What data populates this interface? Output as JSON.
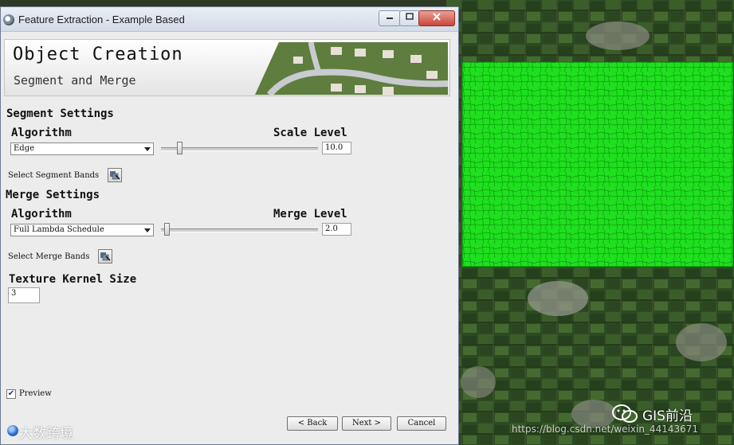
{
  "window": {
    "title": "Feature Extraction - Example Based",
    "buttons": [
      "minimize",
      "maximize",
      "close"
    ]
  },
  "header": {
    "title": "Object Creation",
    "subtitle": "Segment and Merge"
  },
  "segment": {
    "section_label": "Segment Settings",
    "algorithm_label": "Algorithm",
    "algorithm_value": "Edge",
    "scale_label": "Scale Level",
    "scale_value": "10.0",
    "scale_fraction": 0.1,
    "bands_label": "Select Segment Bands"
  },
  "merge": {
    "section_label": "Merge Settings",
    "algorithm_label": "Algorithm",
    "algorithm_value": "Full Lambda Schedule",
    "merge_label": "Merge Level",
    "merge_value": "2.0",
    "merge_fraction": 0.02,
    "bands_label": "Select Merge Bands"
  },
  "texture": {
    "label": "Texture Kernel Size",
    "value": "3"
  },
  "preview": {
    "label": "Preview",
    "checked": true
  },
  "nav": {
    "back_label": "< Back",
    "next_label": "Next >",
    "cancel_label": "Cancel"
  },
  "watermarks": {
    "left": "大数跨境",
    "brand": "GIS前沿",
    "url": "https://blog.csdn.net/weixin_44143671"
  },
  "colors": {
    "segmentation_overlay": "#22ee22",
    "field_green": "#3c5a2a"
  }
}
